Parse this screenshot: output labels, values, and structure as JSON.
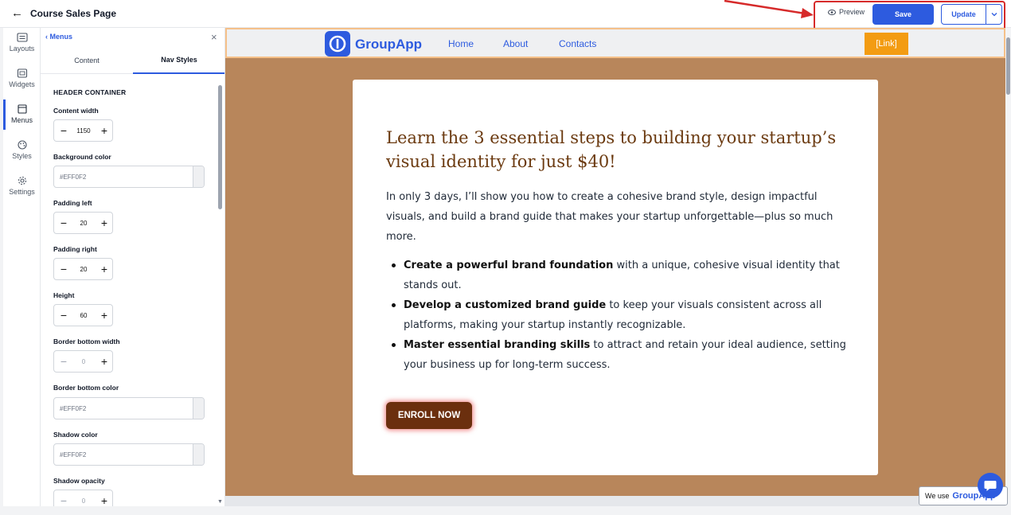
{
  "topbar": {
    "back_icon": "arrow-left-icon",
    "title": "Course Sales Page",
    "preview_label": "Preview",
    "save_label": "Save",
    "update_label": "Update"
  },
  "rail": {
    "items": [
      {
        "label": "Layouts",
        "icon": "layouts-icon"
      },
      {
        "label": "Widgets",
        "icon": "widgets-icon"
      },
      {
        "label": "Menus",
        "icon": "menus-icon"
      },
      {
        "label": "Styles",
        "icon": "palette-icon"
      },
      {
        "label": "Settings",
        "icon": "gear-icon"
      }
    ],
    "active": "Menus"
  },
  "panel": {
    "back_label": "Menus",
    "tabs": [
      "Content",
      "Nav Styles"
    ],
    "active_tab": "Nav Styles",
    "section_title": "HEADER CONTAINER",
    "fields": {
      "content_width": {
        "label": "Content width",
        "value": "1150"
      },
      "background_color": {
        "label": "Background color",
        "value": "#EFF0F2"
      },
      "padding_left": {
        "label": "Padding left",
        "value": "20"
      },
      "padding_right": {
        "label": "Padding right",
        "value": "20"
      },
      "height": {
        "label": "Height",
        "value": "60"
      },
      "border_bottom_width": {
        "label": "Border bottom width",
        "value": "0"
      },
      "border_bottom_color": {
        "label": "Border bottom color",
        "value": "#EFF0F2"
      },
      "shadow_color": {
        "label": "Shadow color",
        "value": "#EFF0F2"
      },
      "shadow_opacity": {
        "label": "Shadow opacity",
        "value": "0"
      }
    }
  },
  "site": {
    "logo_text": "GroupApp",
    "nav_links": [
      "Home",
      "About",
      "Contacts"
    ],
    "nav_cta": "[Link]",
    "headline": "Learn the 3 essential steps to building your startup’s visual identity for just $40!",
    "intro": "In only 3 days, I’ll show you how to create a cohesive brand style, design impactful visuals, and build a brand guide that makes your startup unforgettable—plus so much more.",
    "bullets": [
      {
        "bold": "Create a powerful brand foundation",
        "rest": " with a unique, cohesive visual identity that stands out."
      },
      {
        "bold": "Develop a customized brand guide",
        "rest": " to keep your visuals consistent across all platforms, making your startup instantly recognizable."
      },
      {
        "bold": "Master essential branding skills",
        "rest": " to attract and retain your ideal audience, setting your business up for long-term success."
      }
    ],
    "cta_label": "ENROLL NOW"
  },
  "badge": {
    "prefix": "We use",
    "brand": "GroupApp"
  },
  "colors": {
    "accent": "#2d5bdf",
    "canvas_bg": "#b8865b",
    "headline": "#6b3a10",
    "cta_bg": "#6b2f0e",
    "nav_cta_bg": "#f39c12",
    "annotation_red": "#d62a2a"
  }
}
